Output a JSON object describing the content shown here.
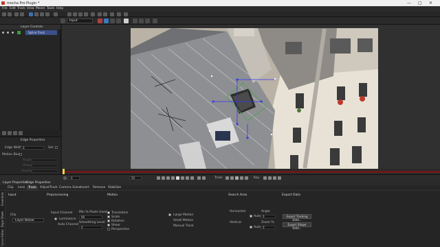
{
  "window": {
    "title": "mocha Pro Plugin *",
    "controls": [
      "—",
      "□",
      "✕"
    ]
  },
  "menu": [
    "File",
    "Edit",
    "Track",
    "View",
    "Movie",
    "Tools",
    "Help"
  ],
  "toolbar2": {
    "layer_select": "Input",
    "frame_value": "0"
  },
  "layer_controls": {
    "header": "Layer Controls",
    "layer_name": "Spline Track"
  },
  "edge_properties": {
    "header": "Edge Properties",
    "edge_width_label": "Edge Width",
    "edge_width_value": "0",
    "set_label": "Set",
    "motion_blur_label": "Motion Blur",
    "angle_label": "Angle",
    "phase_label": "Phase",
    "quality_label": "Quality"
  },
  "transport": {
    "frame": "0",
    "end_frame": "50",
    "track_label": "Track",
    "key_label": "Key"
  },
  "params_title": "Parameters",
  "prop_tabs": [
    "Layer Properties",
    "Edge Properties"
  ],
  "sub_tabs": [
    "Clip",
    "Lens",
    "Track",
    "AdjustTrack",
    "Camera Solve",
    "Insert",
    "Remove",
    "Stabilize"
  ],
  "active_sub_tab": "Track",
  "vertical_tabs": [
    "Essentials",
    "Dope Sheet",
    "Curve Editor"
  ],
  "track_panel": {
    "input_section": "Input",
    "clip_label": "Clip",
    "clip_value": "Layer Below",
    "preprocessing_section": "Preprocessing",
    "input_channel_label": "Input Channel",
    "luminance_label": "Luminance",
    "auto_channel_label": "Auto Channel",
    "min_pixels_label": "Min % Pixels Used",
    "min_pixels_value": "90",
    "smoothing_label": "Smoothing Level",
    "smoothing_value": "0",
    "motion_section": "Motion",
    "translation_label": "Translation",
    "scale_label": "Scale",
    "rotation_label": "Rotation",
    "shear_label": "Shear",
    "perspective_label": "Perspective",
    "large_motion_label": "Large Motion",
    "small_motion_label": "Small Motion",
    "manual_track_label": "Manual Track",
    "search_area_section": "Search Area",
    "horizontal_label": "Horizontal",
    "vertical_label": "Vertical",
    "auto_label": "Auto",
    "horizontal_value": "0",
    "vertical_value": "0",
    "angle_label": "Angle",
    "angle_value": "0",
    "zoom_label": "Zoom %",
    "zoom_value": "0",
    "export_section": "Export Data",
    "export_tracking_button": "Export Tracking Data...",
    "export_shape_button": "Export Shape Data..."
  },
  "colors": {
    "accent": "#3b4f8a",
    "timeline": "#6b1a1a",
    "spline": "#5aa05a",
    "handles": "#3030ff"
  }
}
